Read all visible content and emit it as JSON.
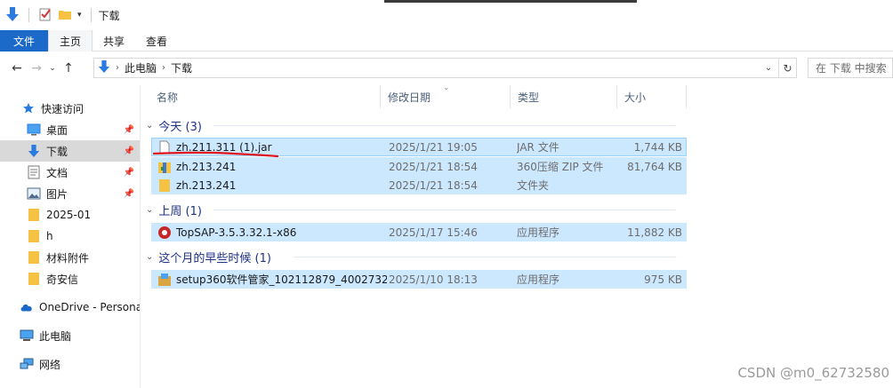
{
  "window": {
    "title": "下载"
  },
  "ribbon": {
    "tabs": [
      "文件",
      "主页",
      "共享",
      "查看"
    ]
  },
  "address": {
    "crumbs": [
      "此电脑",
      "下载"
    ]
  },
  "search": {
    "placeholder": "在 下载 中搜索"
  },
  "sidebar": {
    "items": [
      {
        "label": "快速访问",
        "icon": "star-icon"
      },
      {
        "label": "桌面",
        "icon": "desktop-icon",
        "pinned": true
      },
      {
        "label": "下载",
        "icon": "download-arrow-icon",
        "pinned": true,
        "selected": true
      },
      {
        "label": "文档",
        "icon": "document-icon",
        "pinned": true
      },
      {
        "label": "图片",
        "icon": "picture-icon",
        "pinned": true
      },
      {
        "label": "2025-01",
        "icon": "folder-icon"
      },
      {
        "label": "h",
        "icon": "folder-icon"
      },
      {
        "label": "材料附件",
        "icon": "folder-icon"
      },
      {
        "label": "奇安信",
        "icon": "folder-icon"
      },
      {
        "label": "OneDrive - Persona",
        "icon": "cloud-icon"
      },
      {
        "label": "此电脑",
        "icon": "computer-icon"
      },
      {
        "label": "网络",
        "icon": "network-icon"
      }
    ]
  },
  "columns": {
    "name": "名称",
    "date": "修改日期",
    "type": "类型",
    "size": "大小"
  },
  "groups": [
    {
      "label": "今天 (3)",
      "files": [
        {
          "name": "zh.211.311 (1).jar",
          "date": "2025/1/21 19:05",
          "type": "JAR 文件",
          "size": "1,744 KB",
          "icon": "file-icon"
        },
        {
          "name": "zh.213.241",
          "date": "2025/1/21 18:54",
          "type": "360压缩 ZIP 文件",
          "size": "81,764 KB",
          "icon": "zip-archive-icon"
        },
        {
          "name": "zh.213.241",
          "date": "2025/1/21 18:54",
          "type": "文件夹",
          "size": "",
          "icon": "folder-icon"
        }
      ]
    },
    {
      "label": "上周 (1)",
      "files": [
        {
          "name": "TopSAP-3.5.3.32.1-x86",
          "date": "2025/1/17 15:46",
          "type": "应用程序",
          "size": "11,882 KB",
          "icon": "app-red-icon"
        }
      ]
    },
    {
      "label": "这个月的早些时候 (1)",
      "files": [
        {
          "name": "setup360软件管家_102112879_4002732",
          "date": "2025/1/10 18:13",
          "type": "应用程序",
          "size": "975 KB",
          "icon": "installer-icon"
        }
      ]
    }
  ],
  "watermark": "CSDN @m0_62732580",
  "colors": {
    "selection": "#cce8ff",
    "accent": "#1b6ac9",
    "group_text": "#1e3287",
    "annotation": "#e0141e"
  }
}
